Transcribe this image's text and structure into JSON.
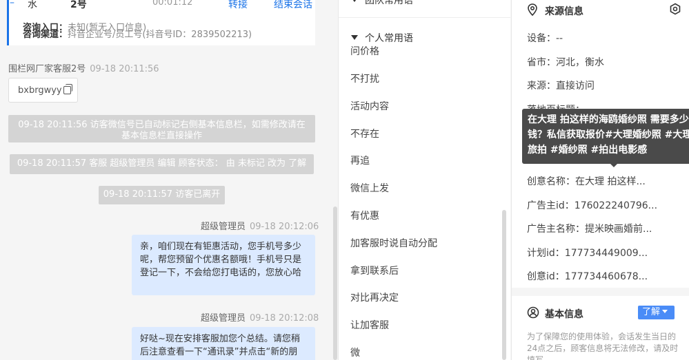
{
  "chat": {
    "header": {
      "left_text": "水",
      "seat_text": "2号",
      "duration": "00:01:12",
      "transfer_label": "转接",
      "end_label": "结束会话"
    },
    "info_row_partial": {
      "key": "咨询入口：",
      "value": "未知(暂无入口信息)"
    },
    "info_channel": {
      "key": "咨询渠道：",
      "value": "抖音企业号/员工号(抖音号ID：2839502213)"
    },
    "msg1": {
      "sender": "围栏网厂家客服2号",
      "time": "09-18 20:11:56"
    },
    "tag_text": "bxbrgwyy",
    "sys1": "09-18 20:11:56 访客微信号已自动标记右侧基本信息栏，如需修改请在基本信息栏直接操作",
    "sys2": "09-18 20:11:57 客服 超级管理员 编辑 顾客状态： 由 未标记 改为 了解",
    "sys3": "09-18 20:11:57 访客已离开",
    "msg2": {
      "sender": "超级管理员",
      "time": "09-18 20:12:06",
      "text": "亲，咱们现在有钜惠活动，您手机号多少呢，帮您预留个优惠名额哦！手机号只是登记一下，不会给您打电话的，您放心哈"
    },
    "msg3": {
      "sender": "超级管理员",
      "time": "09-18 20:12:08",
      "text": "好哒~现在安排客服加您个总结。请您稍后注意查看一下“通讯录”并点击“新的朋"
    }
  },
  "phrases": {
    "team_group": "团队常用语",
    "personal_group": "个人常用语",
    "items": [
      "问价格",
      "不打扰",
      "活动内容",
      "不存在",
      "再追",
      "微信上发",
      "有优惠",
      "加客服时说自动分配",
      "拿到联系后",
      "对比再决定",
      "让加客服",
      "微"
    ]
  },
  "side": {
    "source_title": "来源信息",
    "fields": [
      {
        "key": "设备：",
        "value": "--"
      },
      {
        "key": "省市：",
        "value": "河北，衡水"
      },
      {
        "key": "来源：",
        "value": "直接访问"
      },
      {
        "key": "落地页标题：",
        "value": "--"
      },
      {
        "key": "创意名称：",
        "value": "在大理 拍这样..."
      },
      {
        "key": "广告主id：",
        "value": "176022240796..."
      },
      {
        "key": "广告主名称：",
        "value": "提米映画婚前..."
      },
      {
        "key": "计划id：",
        "value": "177734449009..."
      },
      {
        "key": "创意id：",
        "value": "177734460678..."
      }
    ],
    "tooltip": "在大理 拍这样的海鸥婚纱照 需要多少钱？私信获取报价#大理婚纱照 #大理旅拍 #婚纱照 #拍出电影感",
    "basic_title": "基本信息",
    "learn_label": "了解",
    "notice": "为了保障您的使用体验，会话发生当日的24点之后，顾客信息将无法修改，请及时填写"
  },
  "colors": {
    "accent": "#1a73e8",
    "bubble": "#dceaff",
    "system_bg": "#d4d4d4",
    "learn_button": "#4a8cf7",
    "tooltip_bg": "#4a4a4a"
  }
}
